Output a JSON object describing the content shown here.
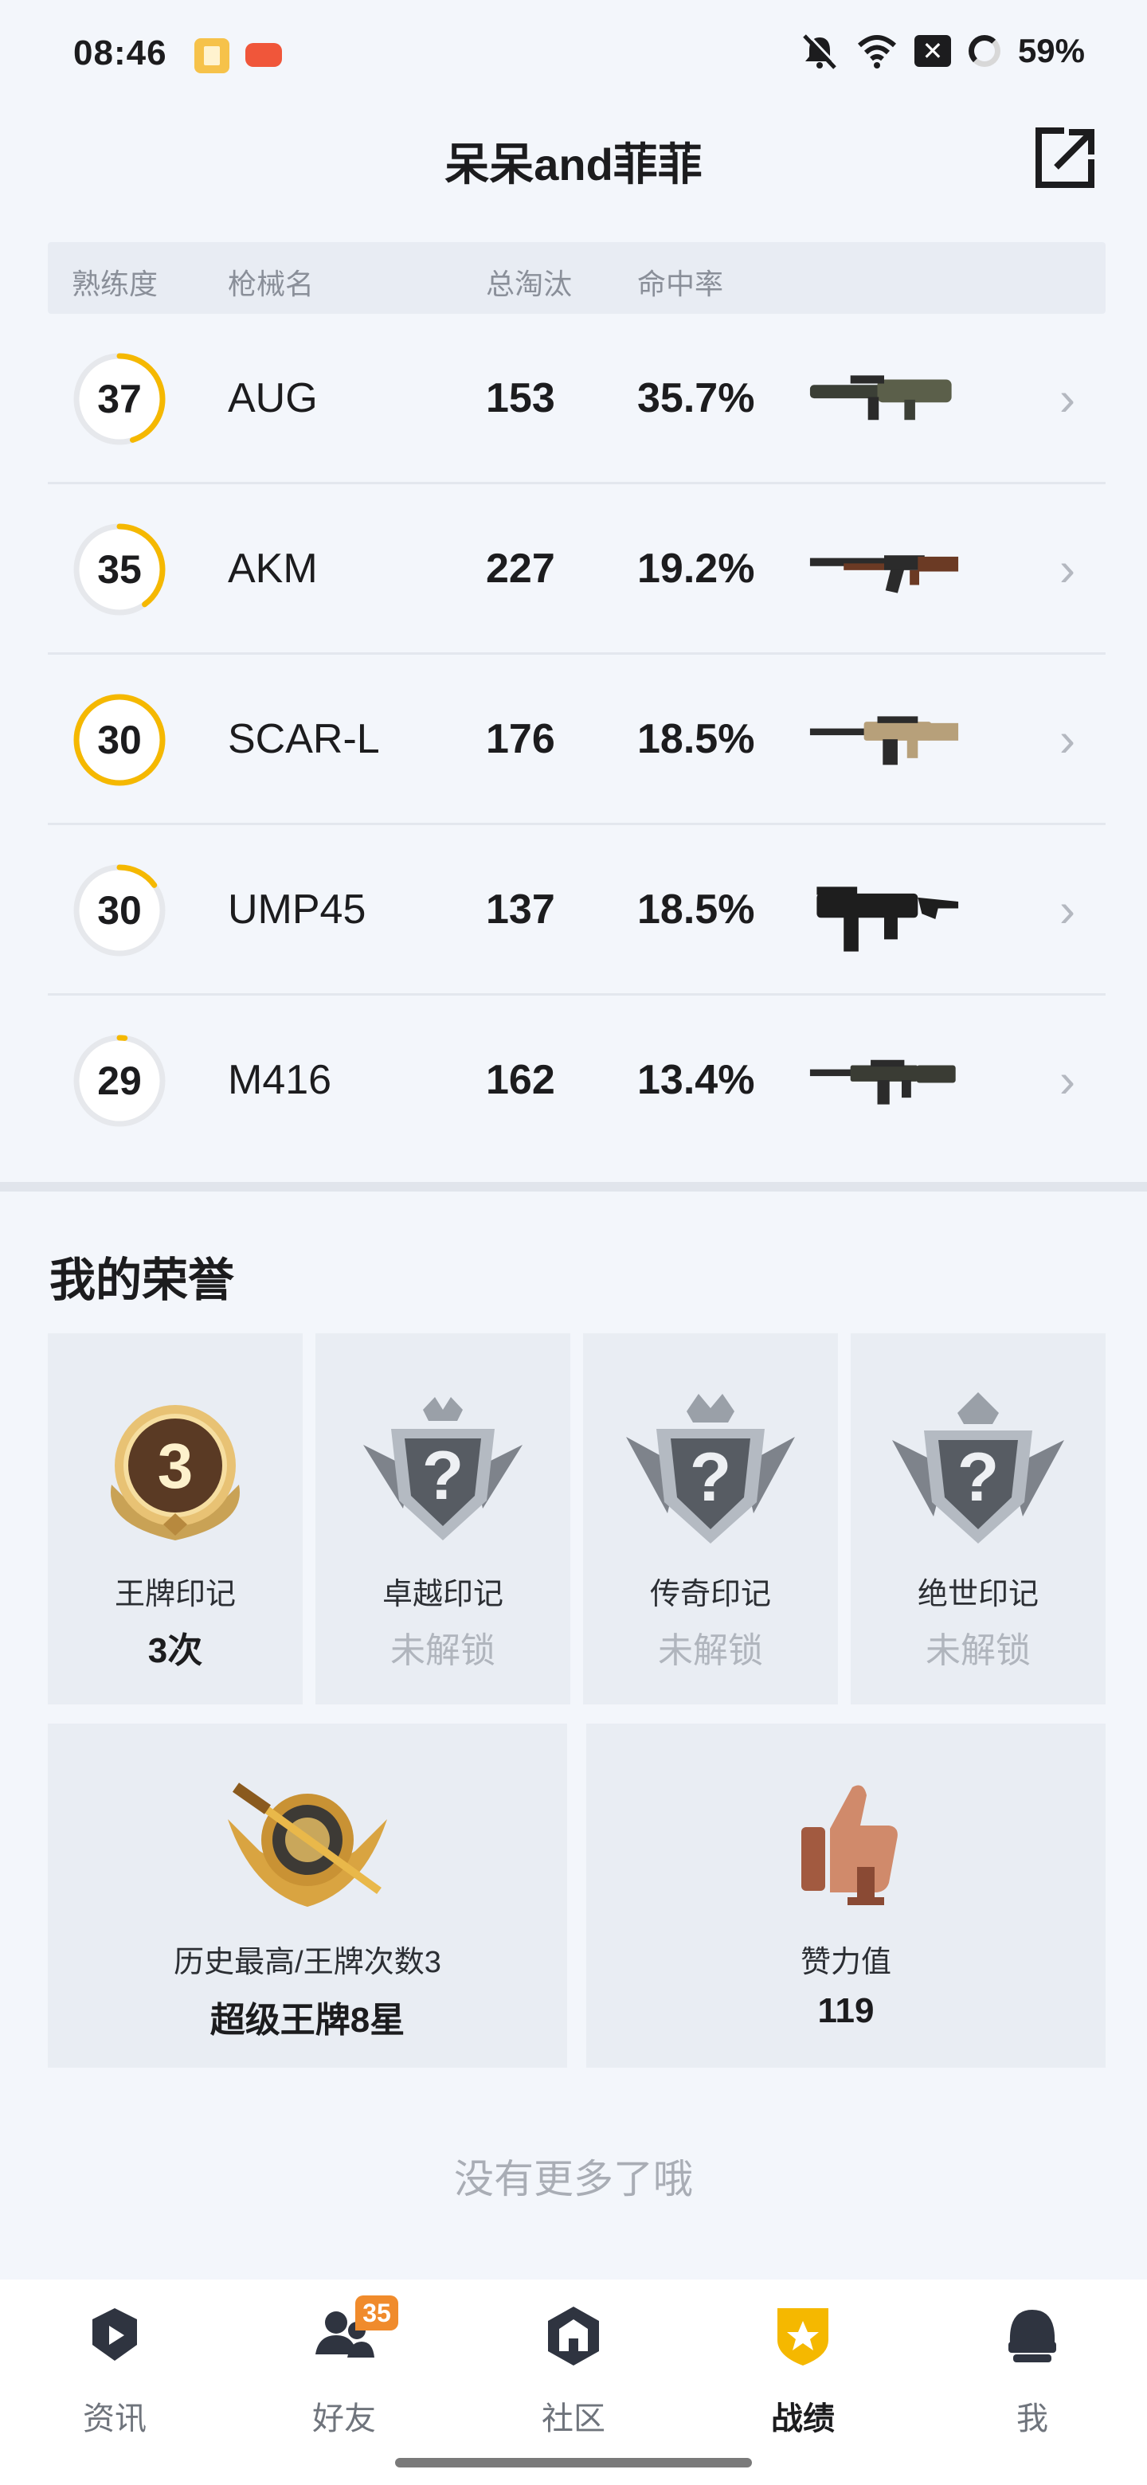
{
  "status_bar": {
    "time": "08:46",
    "battery_text": "59%",
    "icons": [
      "mute-bell-icon",
      "wifi-icon",
      "close-box-icon",
      "battery-ring-icon"
    ]
  },
  "header": {
    "title": "呆呆and菲菲",
    "share_icon": "share-icon"
  },
  "weapon_table": {
    "columns": [
      "熟练度",
      "枪械名",
      "总淘汰",
      "命中率"
    ],
    "rows": [
      {
        "mastery": "37",
        "mastery_progress": 0.45,
        "name": "AUG",
        "kills": "153",
        "hit_rate": "35.7%",
        "gun": "aug"
      },
      {
        "mastery": "35",
        "mastery_progress": 0.4,
        "name": "AKM",
        "kills": "227",
        "hit_rate": "19.2%",
        "gun": "akm"
      },
      {
        "mastery": "30",
        "mastery_progress": 1.0,
        "name": "SCAR-L",
        "kills": "176",
        "hit_rate": "18.5%",
        "gun": "scar"
      },
      {
        "mastery": "30",
        "mastery_progress": 0.15,
        "name": "UMP45",
        "kills": "137",
        "hit_rate": "18.5%",
        "gun": "ump"
      },
      {
        "mastery": "29",
        "mastery_progress": 0.02,
        "name": "M416",
        "kills": "162",
        "hit_rate": "13.4%",
        "gun": "m416"
      }
    ]
  },
  "honors": {
    "title": "我的荣誉",
    "badges": [
      {
        "label": "王牌印记",
        "value": "3次",
        "locked": false,
        "icon_digit": "3"
      },
      {
        "label": "卓越印记",
        "value": "未解锁",
        "locked": true,
        "icon_digit": "?"
      },
      {
        "label": "传奇印记",
        "value": "未解锁",
        "locked": true,
        "icon_digit": "?"
      },
      {
        "label": "绝世印记",
        "value": "未解锁",
        "locked": true,
        "icon_digit": "?"
      }
    ],
    "rank_card": {
      "label": "历史最高/王牌次数3",
      "value": "超级王牌8星"
    },
    "likes_card": {
      "label": "赞力值",
      "value": "119"
    }
  },
  "footer_text": "没有更多了哦",
  "colors": {
    "accent": "#f5b800",
    "ring_track": "#e6e8ec",
    "background": "#f3f6fb"
  },
  "bottom_nav": {
    "items": [
      {
        "label": "资讯",
        "icon": "news-icon"
      },
      {
        "label": "好友",
        "icon": "friends-icon",
        "badge": "35"
      },
      {
        "label": "社区",
        "icon": "community-icon"
      },
      {
        "label": "战绩",
        "icon": "record-icon",
        "active": true
      },
      {
        "label": "我",
        "icon": "profile-helmet-icon"
      }
    ]
  }
}
